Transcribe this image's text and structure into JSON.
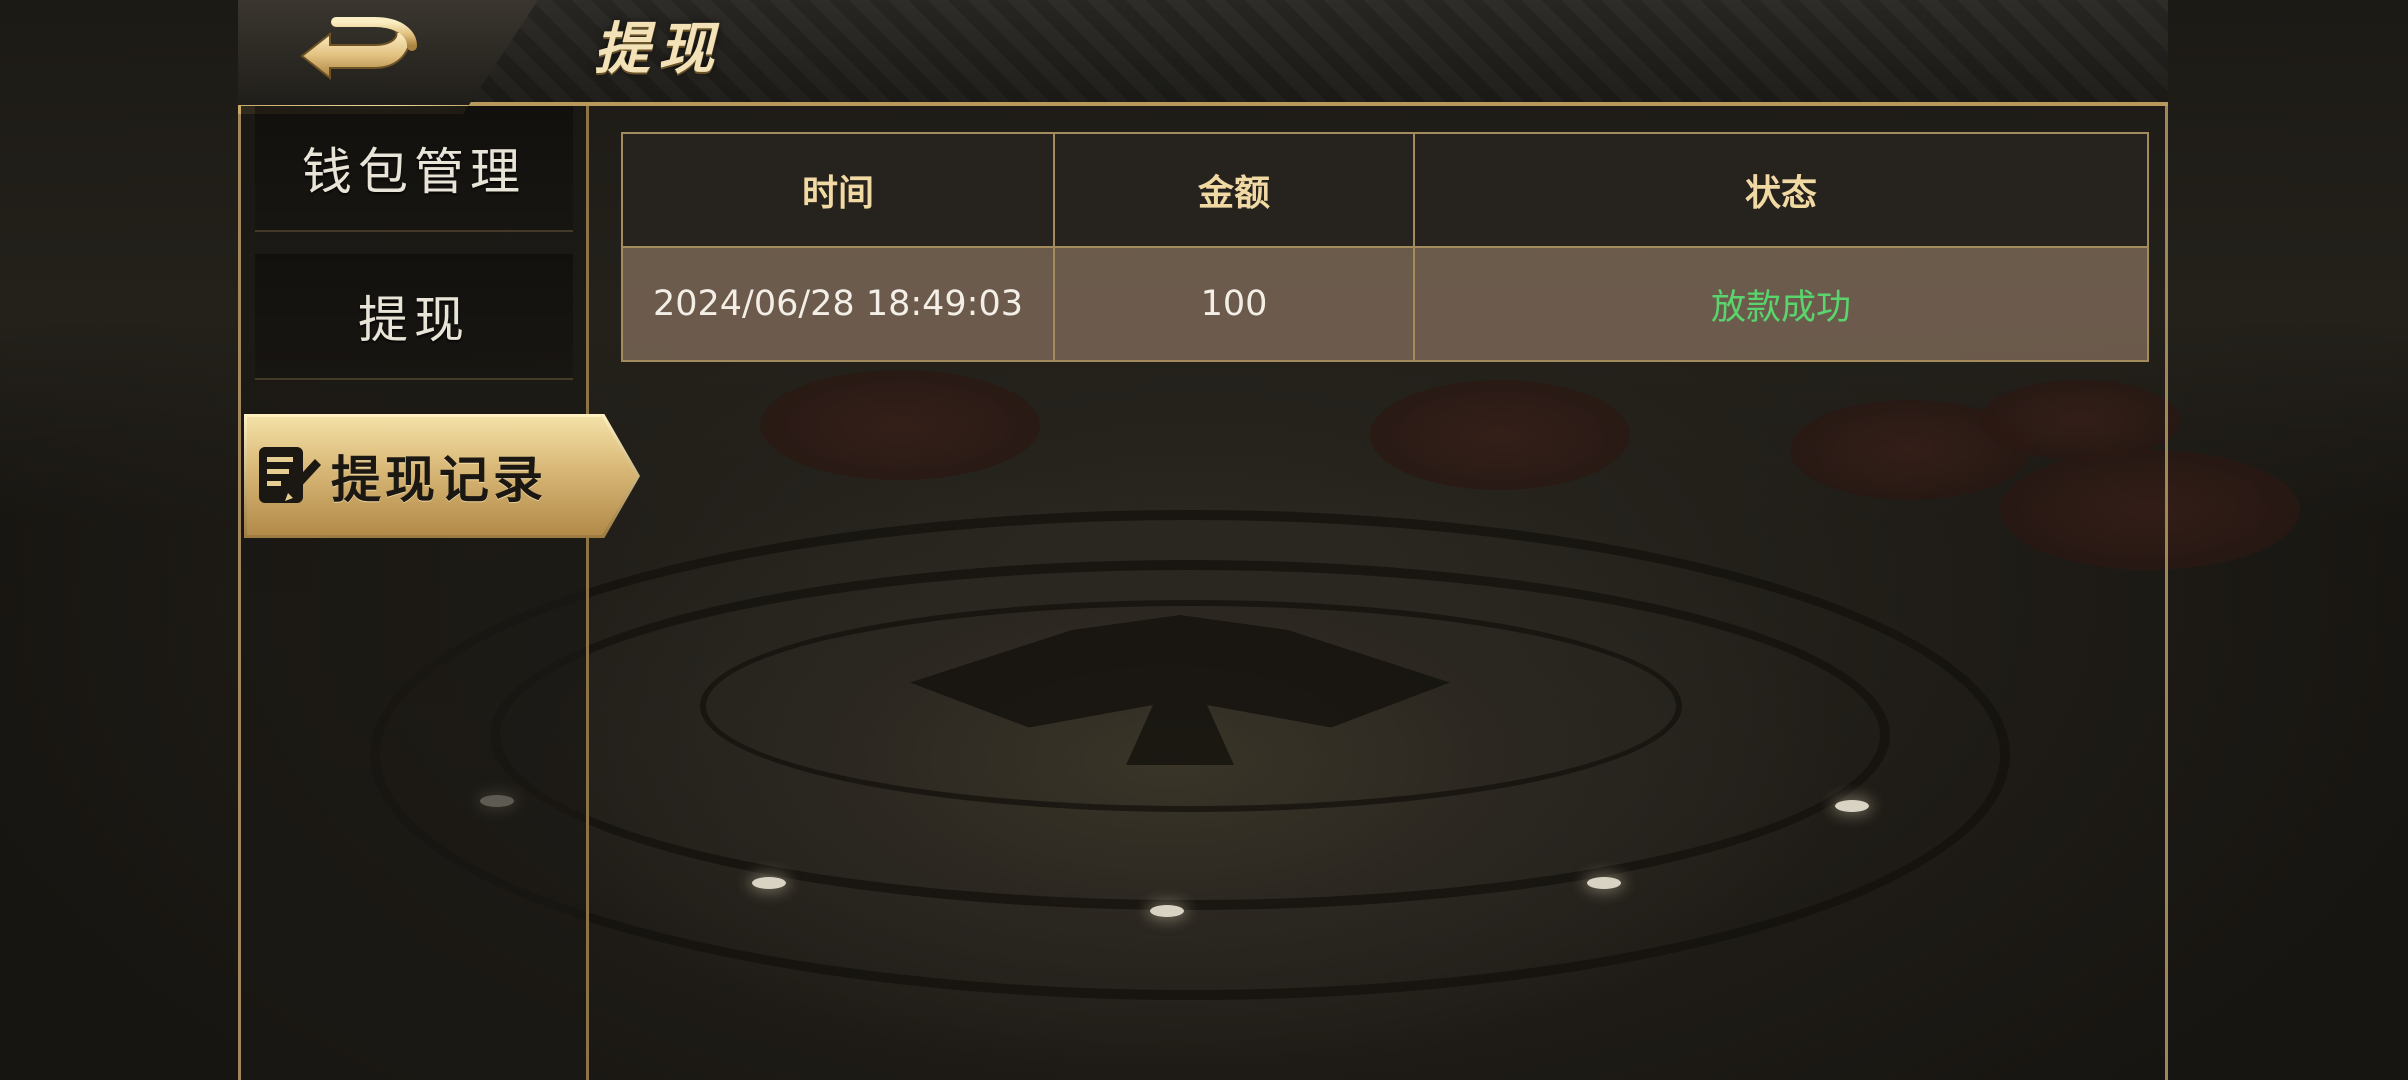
{
  "header": {
    "title": "提现"
  },
  "sidebar": {
    "items": [
      {
        "label": "钱包管理"
      },
      {
        "label": "提现"
      },
      {
        "label": "提现记录"
      }
    ]
  },
  "table": {
    "headers": [
      "时间",
      "金额",
      "状态"
    ],
    "rows": [
      {
        "time": "2024/06/28 18:49:03",
        "amount": "100",
        "status": "放款成功"
      }
    ]
  },
  "colors": {
    "accent_gold": "#d8b776",
    "status_success": "#5ad46d",
    "header_text": "#f1d9a4"
  },
  "icons": {
    "back": "back-arrow-icon",
    "record": "document-pen-icon"
  }
}
